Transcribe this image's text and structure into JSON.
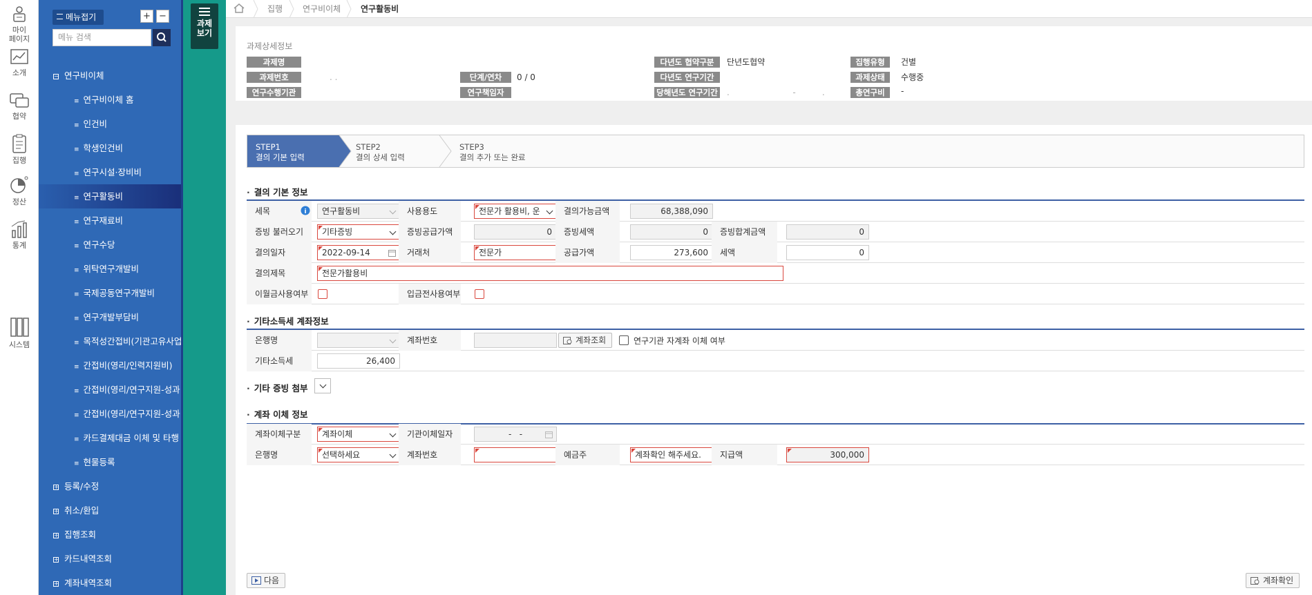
{
  "rail": [
    {
      "label": "마이\n페이지",
      "icon": "mypage-icon"
    },
    {
      "label": "소개",
      "icon": "chart-intro-icon"
    },
    {
      "label": "협약",
      "icon": "chat-agreement-icon"
    },
    {
      "label": "집행",
      "icon": "clipboard-execution-icon"
    },
    {
      "label": "정산",
      "icon": "pie-settlement-icon"
    },
    {
      "label": "통계",
      "icon": "bar-stats-icon"
    },
    {
      "label": "시스템",
      "icon": "system-binders-icon"
    }
  ],
  "sidebar": {
    "collapse_label": "메뉴접기",
    "plus": "+",
    "minus": "−",
    "search_placeholder": "메뉴 검색",
    "items": [
      {
        "label": "연구비이체",
        "level": "top",
        "marker": "−"
      },
      {
        "label": "연구비이체 홈",
        "level": "sub"
      },
      {
        "label": "인건비",
        "level": "sub"
      },
      {
        "label": "학생인건비",
        "level": "sub"
      },
      {
        "label": "연구시설·장비비",
        "level": "sub"
      },
      {
        "label": "연구활동비",
        "level": "sub",
        "active": true
      },
      {
        "label": "연구재료비",
        "level": "sub"
      },
      {
        "label": "연구수당",
        "level": "sub"
      },
      {
        "label": "위탁연구개발비",
        "level": "sub"
      },
      {
        "label": "국제공동연구개발비",
        "level": "sub"
      },
      {
        "label": "연구개발부담비",
        "level": "sub"
      },
      {
        "label": "목적성간접비(기관고유사업",
        "level": "sub"
      },
      {
        "label": "간접비(영리/인력지원비)",
        "level": "sub"
      },
      {
        "label": "간접비(영리/연구지원-성과",
        "level": "sub"
      },
      {
        "label": "간접비(영리/연구지원-성과",
        "level": "sub"
      },
      {
        "label": "카드결제대금 이체 및 타행",
        "level": "sub"
      },
      {
        "label": "현물등록",
        "level": "sub"
      },
      {
        "label": "등록/수정",
        "level": "top",
        "marker": "+"
      },
      {
        "label": "취소/환입",
        "level": "top",
        "marker": "+"
      },
      {
        "label": "집행조회",
        "level": "top",
        "marker": "+"
      },
      {
        "label": "카드내역조회",
        "level": "top",
        "marker": "+"
      },
      {
        "label": "계좌내역조회",
        "level": "top",
        "marker": "+"
      }
    ]
  },
  "project_button": {
    "label1": "과제",
    "label2": "보기"
  },
  "breadcrumb": {
    "items": [
      "집행",
      "연구비이체",
      "연구활동비"
    ]
  },
  "project_info": {
    "title": "과제상세정보",
    "labels": {
      "project_name": "과제명",
      "project_number": "과제번호",
      "stage_year": "단계/연차",
      "institution": "연구수행기관",
      "pi": "연구책임자",
      "multi_year_type": "다년도 협약구분",
      "multi_year_period": "다년도 연구기간",
      "current_year_period": "당해년도 연구기간",
      "exec_type": "집행유형",
      "status": "과제상태",
      "total_budget": "총연구비"
    },
    "values": {
      "stage_year": "0 / 0",
      "multi_year_type": "단년도협약",
      "exec_type": "건별",
      "status": "수행중",
      "total_budget": "-",
      "project_number": ".       .",
      "current_year_period": ".                        -          ."
    }
  },
  "steps": [
    {
      "step": "STEP1",
      "label": "결의 기본 입력",
      "active": true
    },
    {
      "step": "STEP2",
      "label": "결의 상세 입력"
    },
    {
      "step": "STEP3",
      "label": "결의 추가 또는 완료"
    }
  ],
  "basic": {
    "title": "결의 기본 정보",
    "item_label": "세목",
    "item_value": "연구활동비",
    "usage_label": "사용용도",
    "usage_value": "전문가 활용비, 운",
    "available_label": "결의가능금액",
    "available_value": "68,388,090",
    "evidence_label": "증빙 불러오기",
    "evidence_value": "기타증빙",
    "evidence_supply_label": "증빙공급가액",
    "evidence_supply_value": "0",
    "evidence_tax_label": "증빙세액",
    "evidence_tax_value": "0",
    "evidence_total_label": "증빙합계금액",
    "evidence_total_value": "0",
    "date_label": "결의일자",
    "date_value": "2022-09-14",
    "vendor_label": "거래처",
    "vendor_value": "전문가",
    "supply_label": "공급가액",
    "supply_value": "273,600",
    "tax_label": "세액",
    "tax_value": "0",
    "subject_label": "결의제목",
    "subject_value": "전문가활용비",
    "carryover_label": "이월금사용여부",
    "prepay_label": "입금전사용여부"
  },
  "income_tax": {
    "title": "기타소득세 계좌정보",
    "bank_label": "은행명",
    "account_label": "계좌번호",
    "lookup_button": "계좌조회",
    "self_transfer_label": "연구기관 자계좌 이체 여부",
    "tax_label": "기타소득세",
    "tax_value": "26,400"
  },
  "attachment": {
    "title": "기타 증빙 첨부"
  },
  "transfer": {
    "title": "계좌 이체 정보",
    "type_label": "계좌이체구분",
    "type_value": "계좌이체",
    "inst_date_label": "기관이체일자",
    "inst_date_value": "-   -",
    "bank_label": "은행명",
    "bank_value": "선택하세요",
    "account_label": "계좌번호",
    "holder_label": "예금주",
    "holder_value": "계좌확인 해주세요.",
    "amount_label": "지급액",
    "amount_value": "300,000"
  },
  "footer": {
    "next_button": "다음",
    "confirm_button": "계좌확인"
  },
  "colors": {
    "sidebar": "#2f69b6",
    "green": "#159a8a",
    "accent": "#3c5fa4",
    "required": "#d9463c"
  }
}
